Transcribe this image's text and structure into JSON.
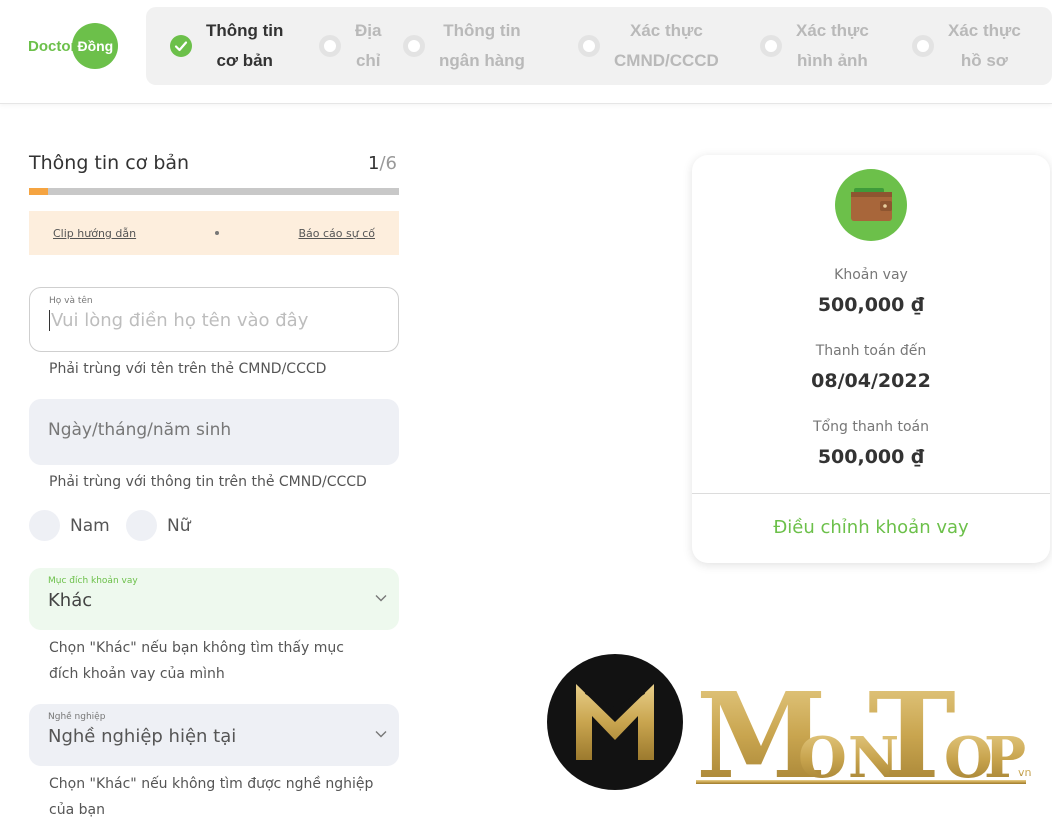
{
  "brand": {
    "logo_left": "Doctor",
    "logo_right": "Đồng"
  },
  "steps": [
    {
      "line1": "Thông tin",
      "line2": "cơ bản",
      "state": "done"
    },
    {
      "line1": "Địa",
      "line2": "chỉ",
      "state": "pending"
    },
    {
      "line1": "Thông tin",
      "line2": "ngân hàng",
      "state": "pending"
    },
    {
      "line1": "Xác thực",
      "line2": "CMND/CCCD",
      "state": "pending"
    },
    {
      "line1": "Xác thực",
      "line2": "hình ảnh",
      "state": "pending"
    },
    {
      "line1": "Xác thực",
      "line2": "hồ sơ",
      "state": "pending"
    }
  ],
  "form": {
    "title": "Thông tin cơ bản",
    "step_current": "1",
    "step_total": "/6",
    "progress_fraction": 0.05,
    "help_video": "Clip hướng dẫn",
    "help_report": "Báo cáo sự cố",
    "name_label": "Họ và tên",
    "name_placeholder": "Vui lòng điền họ tên vào đây",
    "name_hint": "Phải trùng với tên trên thẻ CMND/CCCD",
    "dob_placeholder": "Ngày/tháng/năm sinh",
    "dob_hint": "Phải trùng với thông tin trên thẻ CMND/CCCD",
    "gender_male": "Nam",
    "gender_female": "Nữ",
    "purpose_label": "Mục đích khoản vay",
    "purpose_value": "Khác",
    "purpose_hint_1": "Chọn \"Khác\" nếu bạn không tìm thấy mục",
    "purpose_hint_2": "đích khoản vay của mình",
    "job_label": "Nghề nghiệp",
    "job_value": "Nghề nghiệp hiện tại",
    "job_hint_1": "Chọn \"Khác\" nếu không tìm được nghề nghiệp",
    "job_hint_2": "của bạn"
  },
  "loan_card": {
    "amount_label": "Khoản vay",
    "amount_value": "500,000 ₫",
    "due_label": "Thanh toán đến",
    "due_value": "08/04/2022",
    "total_label": "Tổng thanh toán",
    "total_value": "500,000 ₫",
    "adjust_label": "Điều chỉnh khoản vay"
  },
  "watermark": {
    "letters": [
      "M",
      "O",
      "N",
      "T",
      "O",
      "P"
    ],
    "suffix": "vn"
  },
  "colors": {
    "brand_green": "#6cc04a",
    "progress_orange": "#f5a441",
    "help_bg": "#fdeedd",
    "input_bg": "#eef0f5",
    "gold": "#c9a54f"
  }
}
